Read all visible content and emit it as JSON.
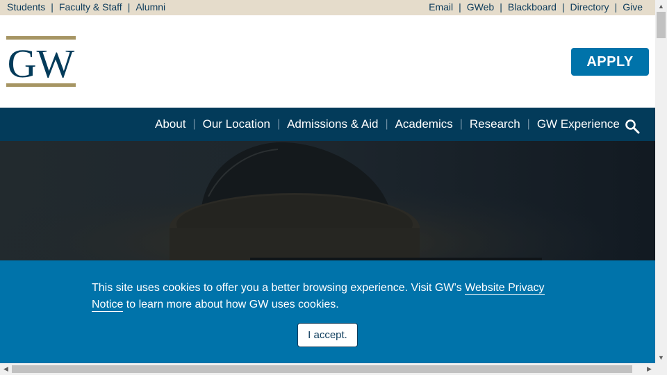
{
  "utility_nav": {
    "left": [
      "Students",
      "Faculty & Staff",
      "Alumni"
    ],
    "right": [
      "Email",
      "GWeb",
      "Blackboard",
      "Directory",
      "Give"
    ],
    "separator": "|"
  },
  "header": {
    "logo_text": "GW",
    "apply_label": "APPLY"
  },
  "main_nav": {
    "items": [
      "About",
      "Our Location",
      "Admissions & Aid",
      "Academics",
      "Research",
      "GW Experience"
    ],
    "separator": "|",
    "search_icon": "search-icon"
  },
  "cookie_banner": {
    "text_before": "This site uses cookies to offer you a better browsing experience. Visit GW’s ",
    "link_text": "Website Privacy Notice",
    "text_after": " to learn more about how GW uses cookies.",
    "accept_label": "I accept."
  },
  "colors": {
    "utility_bg": "#e5dccb",
    "nav_bg": "#033b5a",
    "accent_blue": "#0073aa",
    "logo_navy": "#033b5a",
    "logo_gold": "#a69563"
  }
}
